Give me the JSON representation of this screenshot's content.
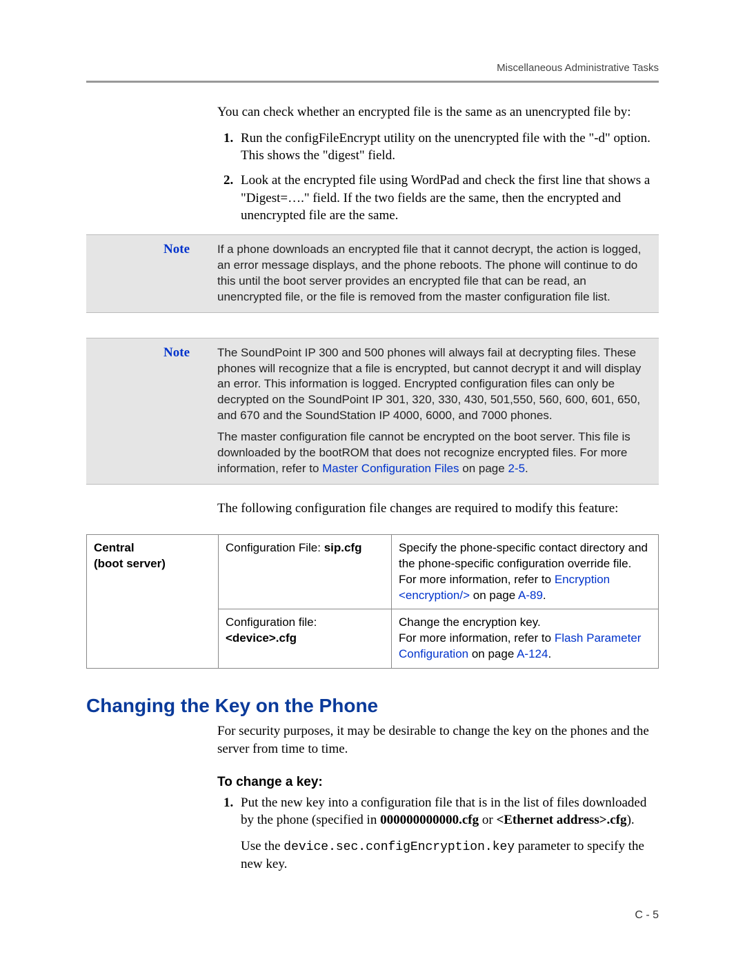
{
  "header": {
    "running_head": "Miscellaneous Administrative Tasks"
  },
  "intro": {
    "check_line": "You can check whether an encrypted file is the same as an unencrypted file by:",
    "step1": "Run the configFileEncrypt utility on the unencrypted file with the \"-d\" option. This shows the \"digest\" field.",
    "step2": "Look at the encrypted file using WordPad and check the first line that shows a \"Digest=….\" field. If the two fields are the same, then the encrypted and unencrypted file are the same."
  },
  "notes": {
    "label": "Note",
    "n1": "If a phone downloads an encrypted file that it cannot decrypt, the action is logged, an error message displays, and the phone reboots. The phone will continue to do this until the boot server provides an encrypted file that can be read, an unencrypted file, or the file is removed from the master configuration file list.",
    "n2a": "The SoundPoint IP 300 and 500 phones will always fail at decrypting files. These phones will recognize that a file is encrypted, but cannot decrypt it and will display an error. This information is logged. Encrypted configuration files can only be decrypted on the SoundPoint IP 301, 320, 330, 430, 501,550, 560, 600, 601, 650, and 670 and the SoundStation IP 4000, 6000, and 7000 phones.",
    "n2b_pre": "The master configuration file cannot be encrypted on the boot server. This file is downloaded by the bootROM that does not recognize encrypted files. For more information, refer to ",
    "n2b_link": "Master Configuration Files",
    "n2b_mid": " on page ",
    "n2b_page": "2-5",
    "n2b_post": "."
  },
  "followup": "The following configuration file changes are required to modify this feature:",
  "table": {
    "r1c1a": "Central",
    "r1c1b": "(boot server)",
    "r1c2_pre": "Configuration File: ",
    "r1c2_bold": "sip.cfg",
    "r1c3_line1": "Specify the phone-specific contact directory and the phone-specific configuration override file.",
    "r1c3_pre": "For more information, refer to ",
    "r1c3_link1": "Encryption <encryption/>",
    "r1c3_mid": " on page ",
    "r1c3_page": "A-89",
    "r1c3_post": ".",
    "r2c2_line1": "Configuration file:",
    "r2c2_bold": "<device>.cfg",
    "r2c3_line1": "Change the encryption key.",
    "r2c3_pre": "For more information, refer to ",
    "r2c3_link": "Flash Parameter Configuration",
    "r2c3_mid": " on page ",
    "r2c3_page": "A-124",
    "r2c3_post": "."
  },
  "section": {
    "heading": "Changing the Key on the Phone",
    "p1": "For security purposes, it may be desirable to change the key on the phones and the server from time to time.",
    "subhead": "To change a key:",
    "step1_pre": "Put the new key into a configuration file that is in the list of files downloaded by the phone (specified in ",
    "step1_b1": "000000000000.cfg",
    "step1_mid": " or ",
    "step1_b2": "<Ethernet address>.cfg",
    "step1_post": ").",
    "step1_p2_pre": "Use the ",
    "step1_code": "device.sec.configEncryption.key",
    "step1_p2_post": " parameter to specify the new key."
  },
  "footer": {
    "page": "C - 5"
  }
}
